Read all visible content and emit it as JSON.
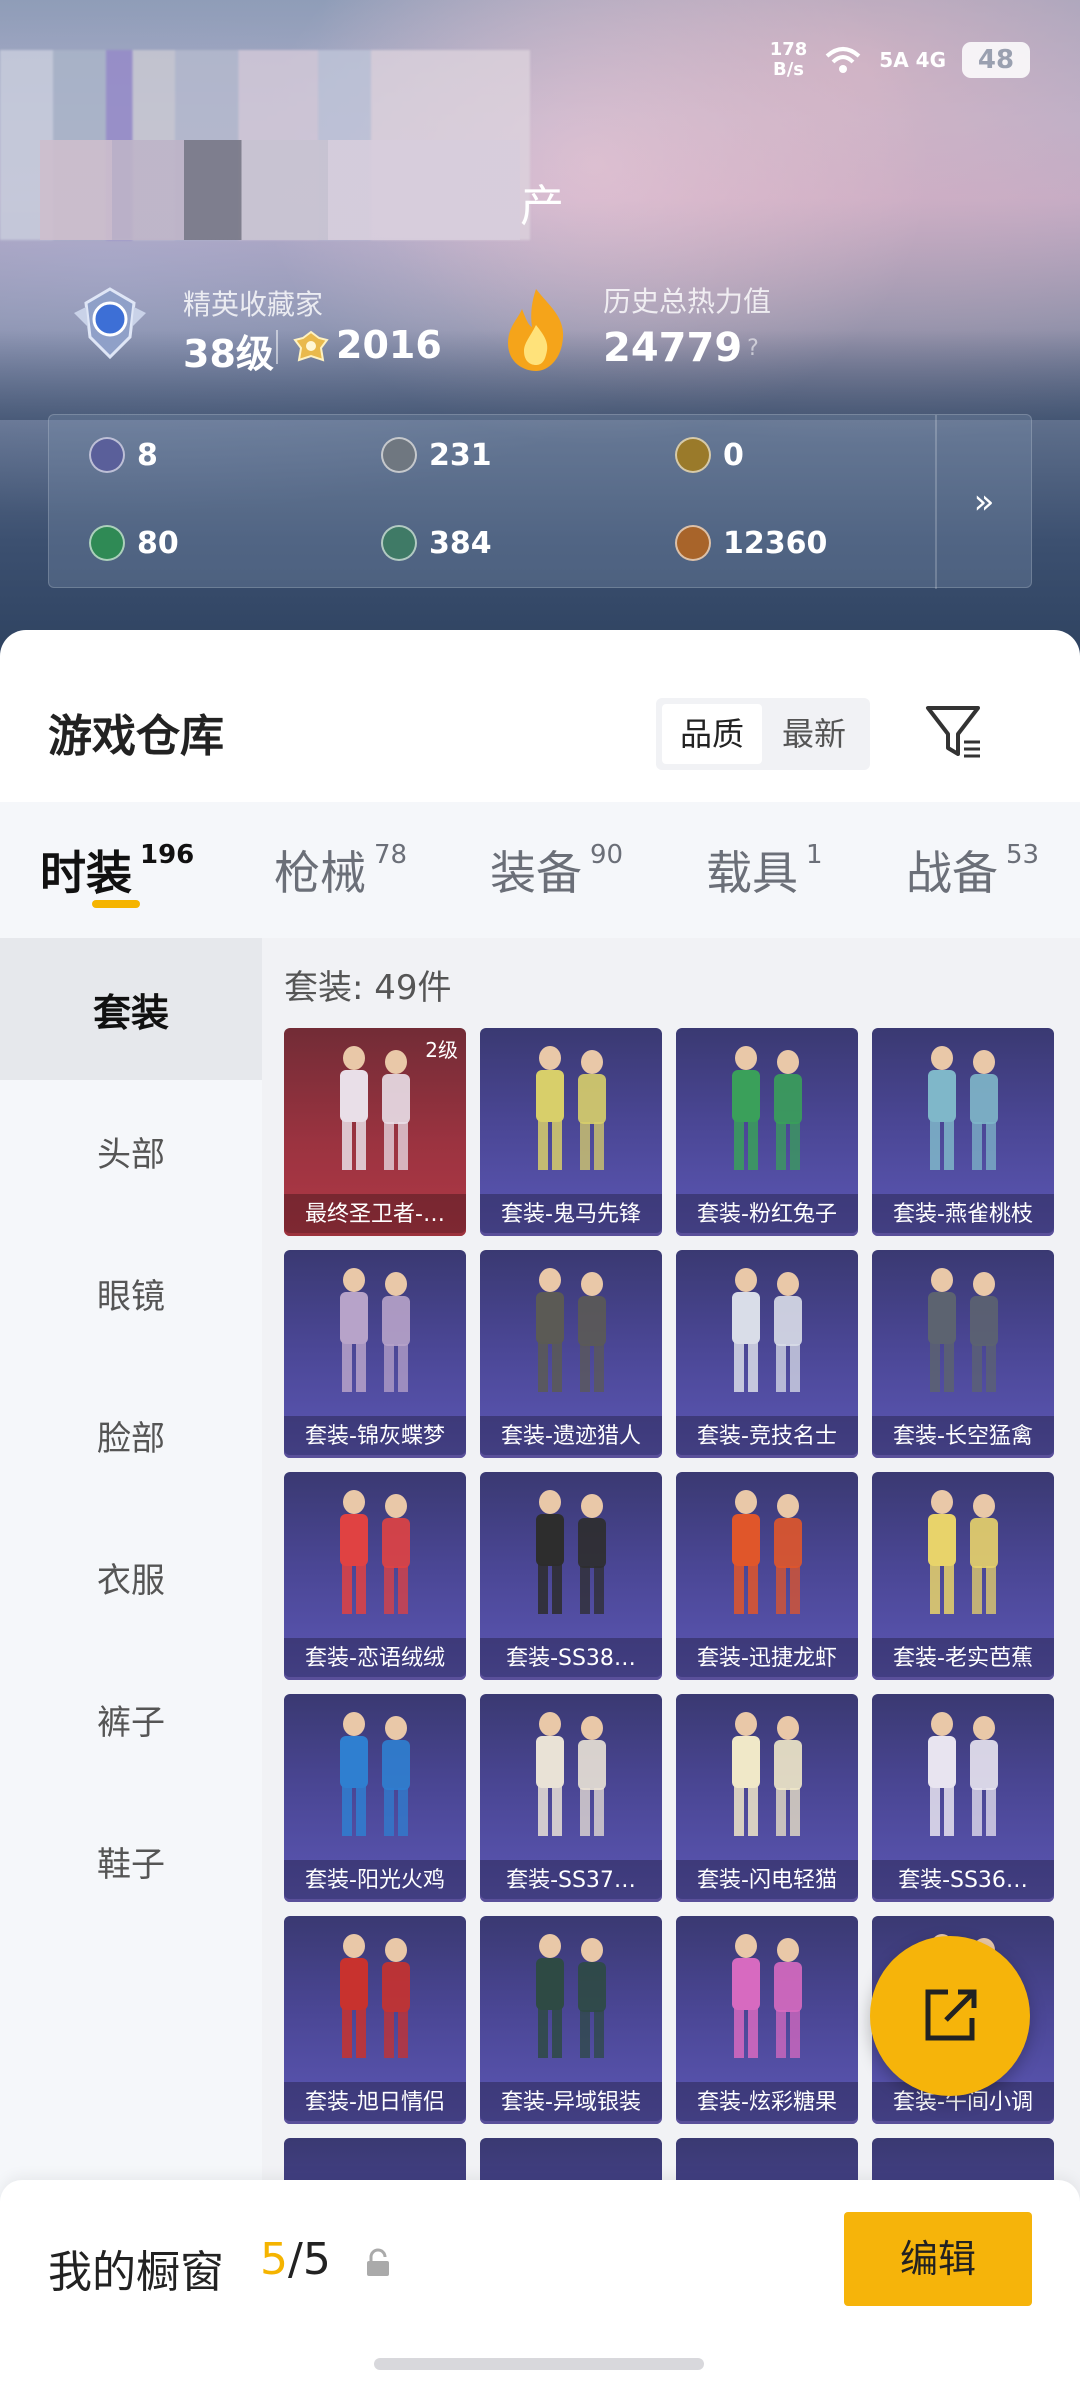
{
  "status_bar": {
    "net_speed_value": "178",
    "net_speed_unit": "B/s",
    "signal": "5A 4G",
    "battery": "48"
  },
  "header": {
    "title_fragment": "产"
  },
  "collector": {
    "rank_name": "精英收藏家",
    "level": "38级",
    "points": "2016"
  },
  "heat": {
    "label": "历史总热力值",
    "value": "24779",
    "help": "?"
  },
  "resources": [
    {
      "icon": "card-icon",
      "value": "8",
      "color": "#5a5f9a"
    },
    {
      "icon": "silver-coin-icon",
      "value": "231",
      "color": "#6f7780"
    },
    {
      "icon": "gold-coin-icon",
      "value": "0",
      "color": "#9a7a2a"
    },
    {
      "icon": "green-card-icon",
      "value": "80",
      "color": "#2f8a55"
    },
    {
      "icon": "teal-coin-icon",
      "value": "384",
      "color": "#3f7a66"
    },
    {
      "icon": "bronze-coin-icon",
      "value": "12360",
      "color": "#a8642a"
    }
  ],
  "resources_more": "»",
  "warehouse": {
    "title": "游戏仓库",
    "sort": [
      {
        "label": "品质"
      },
      {
        "label": "最新"
      }
    ]
  },
  "categories": [
    {
      "label": "时装",
      "count": "196"
    },
    {
      "label": "枪械",
      "count": "78"
    },
    {
      "label": "装备",
      "count": "90"
    },
    {
      "label": "载具",
      "count": "1"
    },
    {
      "label": "战备",
      "count": "53"
    }
  ],
  "subcategories": [
    {
      "label": "套装"
    },
    {
      "label": "头部"
    },
    {
      "label": "眼镜"
    },
    {
      "label": "脸部"
    },
    {
      "label": "衣服"
    },
    {
      "label": "裤子"
    },
    {
      "label": "鞋子"
    }
  ],
  "content": {
    "count_label": "套装: 49件"
  },
  "items": [
    {
      "name": "最终圣卫者-…",
      "level": "2级",
      "rarity": "red"
    },
    {
      "name": "套装-鬼马先锋"
    },
    {
      "name": "套装-粉红兔子"
    },
    {
      "name": "套装-燕雀桃枝"
    },
    {
      "name": "套装-锦灰蝶梦"
    },
    {
      "name": "套装-遗迹猎人"
    },
    {
      "name": "套装-竞技名士"
    },
    {
      "name": "套装-长空猛禽"
    },
    {
      "name": "套装-恋语绒绒"
    },
    {
      "name": "套装-SS38…"
    },
    {
      "name": "套装-迅捷龙虾"
    },
    {
      "name": "套装-老实芭蕉"
    },
    {
      "name": "套装-阳光火鸡"
    },
    {
      "name": "套装-SS37…"
    },
    {
      "name": "套装-闪电轻猫"
    },
    {
      "name": "套装-SS36…"
    },
    {
      "name": "套装-旭日情侣"
    },
    {
      "name": "套装-异域银装"
    },
    {
      "name": "套装-炫彩糖果"
    },
    {
      "name": "套装-午间小调"
    }
  ],
  "showcase": {
    "title": "我的橱窗",
    "current": "5",
    "total": "/5",
    "edit": "编辑"
  },
  "colors": {
    "accent": "#f6b40a",
    "card_purple": "#4a4694",
    "card_red": "#9b3340"
  }
}
